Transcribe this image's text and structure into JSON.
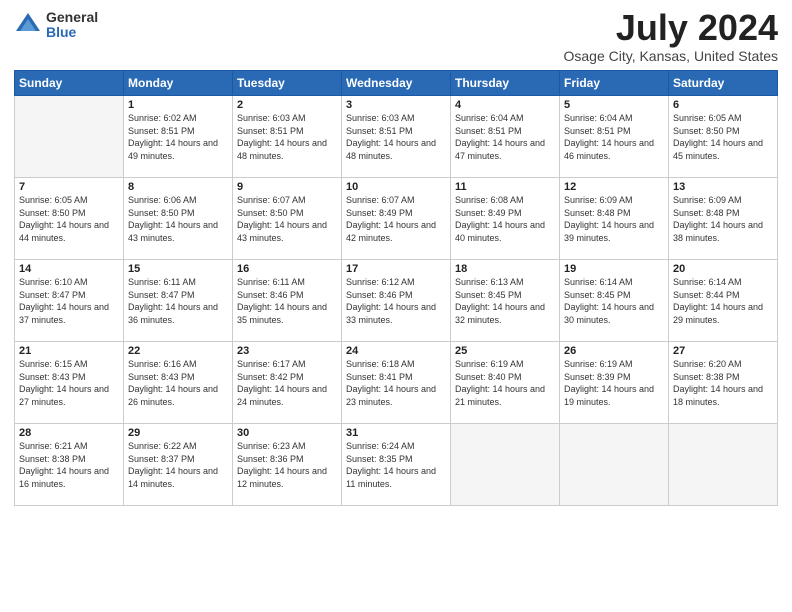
{
  "logo": {
    "general": "General",
    "blue": "Blue"
  },
  "title": "July 2024",
  "location": "Osage City, Kansas, United States",
  "days_of_week": [
    "Sunday",
    "Monday",
    "Tuesday",
    "Wednesday",
    "Thursday",
    "Friday",
    "Saturday"
  ],
  "weeks": [
    [
      {
        "day": "",
        "sunrise": "",
        "sunset": "",
        "daylight": ""
      },
      {
        "day": "1",
        "sunrise": "Sunrise: 6:02 AM",
        "sunset": "Sunset: 8:51 PM",
        "daylight": "Daylight: 14 hours and 49 minutes."
      },
      {
        "day": "2",
        "sunrise": "Sunrise: 6:03 AM",
        "sunset": "Sunset: 8:51 PM",
        "daylight": "Daylight: 14 hours and 48 minutes."
      },
      {
        "day": "3",
        "sunrise": "Sunrise: 6:03 AM",
        "sunset": "Sunset: 8:51 PM",
        "daylight": "Daylight: 14 hours and 48 minutes."
      },
      {
        "day": "4",
        "sunrise": "Sunrise: 6:04 AM",
        "sunset": "Sunset: 8:51 PM",
        "daylight": "Daylight: 14 hours and 47 minutes."
      },
      {
        "day": "5",
        "sunrise": "Sunrise: 6:04 AM",
        "sunset": "Sunset: 8:51 PM",
        "daylight": "Daylight: 14 hours and 46 minutes."
      },
      {
        "day": "6",
        "sunrise": "Sunrise: 6:05 AM",
        "sunset": "Sunset: 8:50 PM",
        "daylight": "Daylight: 14 hours and 45 minutes."
      }
    ],
    [
      {
        "day": "7",
        "sunrise": "Sunrise: 6:05 AM",
        "sunset": "Sunset: 8:50 PM",
        "daylight": "Daylight: 14 hours and 44 minutes."
      },
      {
        "day": "8",
        "sunrise": "Sunrise: 6:06 AM",
        "sunset": "Sunset: 8:50 PM",
        "daylight": "Daylight: 14 hours and 43 minutes."
      },
      {
        "day": "9",
        "sunrise": "Sunrise: 6:07 AM",
        "sunset": "Sunset: 8:50 PM",
        "daylight": "Daylight: 14 hours and 43 minutes."
      },
      {
        "day": "10",
        "sunrise": "Sunrise: 6:07 AM",
        "sunset": "Sunset: 8:49 PM",
        "daylight": "Daylight: 14 hours and 42 minutes."
      },
      {
        "day": "11",
        "sunrise": "Sunrise: 6:08 AM",
        "sunset": "Sunset: 8:49 PM",
        "daylight": "Daylight: 14 hours and 40 minutes."
      },
      {
        "day": "12",
        "sunrise": "Sunrise: 6:09 AM",
        "sunset": "Sunset: 8:48 PM",
        "daylight": "Daylight: 14 hours and 39 minutes."
      },
      {
        "day": "13",
        "sunrise": "Sunrise: 6:09 AM",
        "sunset": "Sunset: 8:48 PM",
        "daylight": "Daylight: 14 hours and 38 minutes."
      }
    ],
    [
      {
        "day": "14",
        "sunrise": "Sunrise: 6:10 AM",
        "sunset": "Sunset: 8:47 PM",
        "daylight": "Daylight: 14 hours and 37 minutes."
      },
      {
        "day": "15",
        "sunrise": "Sunrise: 6:11 AM",
        "sunset": "Sunset: 8:47 PM",
        "daylight": "Daylight: 14 hours and 36 minutes."
      },
      {
        "day": "16",
        "sunrise": "Sunrise: 6:11 AM",
        "sunset": "Sunset: 8:46 PM",
        "daylight": "Daylight: 14 hours and 35 minutes."
      },
      {
        "day": "17",
        "sunrise": "Sunrise: 6:12 AM",
        "sunset": "Sunset: 8:46 PM",
        "daylight": "Daylight: 14 hours and 33 minutes."
      },
      {
        "day": "18",
        "sunrise": "Sunrise: 6:13 AM",
        "sunset": "Sunset: 8:45 PM",
        "daylight": "Daylight: 14 hours and 32 minutes."
      },
      {
        "day": "19",
        "sunrise": "Sunrise: 6:14 AM",
        "sunset": "Sunset: 8:45 PM",
        "daylight": "Daylight: 14 hours and 30 minutes."
      },
      {
        "day": "20",
        "sunrise": "Sunrise: 6:14 AM",
        "sunset": "Sunset: 8:44 PM",
        "daylight": "Daylight: 14 hours and 29 minutes."
      }
    ],
    [
      {
        "day": "21",
        "sunrise": "Sunrise: 6:15 AM",
        "sunset": "Sunset: 8:43 PM",
        "daylight": "Daylight: 14 hours and 27 minutes."
      },
      {
        "day": "22",
        "sunrise": "Sunrise: 6:16 AM",
        "sunset": "Sunset: 8:43 PM",
        "daylight": "Daylight: 14 hours and 26 minutes."
      },
      {
        "day": "23",
        "sunrise": "Sunrise: 6:17 AM",
        "sunset": "Sunset: 8:42 PM",
        "daylight": "Daylight: 14 hours and 24 minutes."
      },
      {
        "day": "24",
        "sunrise": "Sunrise: 6:18 AM",
        "sunset": "Sunset: 8:41 PM",
        "daylight": "Daylight: 14 hours and 23 minutes."
      },
      {
        "day": "25",
        "sunrise": "Sunrise: 6:19 AM",
        "sunset": "Sunset: 8:40 PM",
        "daylight": "Daylight: 14 hours and 21 minutes."
      },
      {
        "day": "26",
        "sunrise": "Sunrise: 6:19 AM",
        "sunset": "Sunset: 8:39 PM",
        "daylight": "Daylight: 14 hours and 19 minutes."
      },
      {
        "day": "27",
        "sunrise": "Sunrise: 6:20 AM",
        "sunset": "Sunset: 8:38 PM",
        "daylight": "Daylight: 14 hours and 18 minutes."
      }
    ],
    [
      {
        "day": "28",
        "sunrise": "Sunrise: 6:21 AM",
        "sunset": "Sunset: 8:38 PM",
        "daylight": "Daylight: 14 hours and 16 minutes."
      },
      {
        "day": "29",
        "sunrise": "Sunrise: 6:22 AM",
        "sunset": "Sunset: 8:37 PM",
        "daylight": "Daylight: 14 hours and 14 minutes."
      },
      {
        "day": "30",
        "sunrise": "Sunrise: 6:23 AM",
        "sunset": "Sunset: 8:36 PM",
        "daylight": "Daylight: 14 hours and 12 minutes."
      },
      {
        "day": "31",
        "sunrise": "Sunrise: 6:24 AM",
        "sunset": "Sunset: 8:35 PM",
        "daylight": "Daylight: 14 hours and 11 minutes."
      },
      {
        "day": "",
        "sunrise": "",
        "sunset": "",
        "daylight": ""
      },
      {
        "day": "",
        "sunrise": "",
        "sunset": "",
        "daylight": ""
      },
      {
        "day": "",
        "sunrise": "",
        "sunset": "",
        "daylight": ""
      }
    ]
  ]
}
